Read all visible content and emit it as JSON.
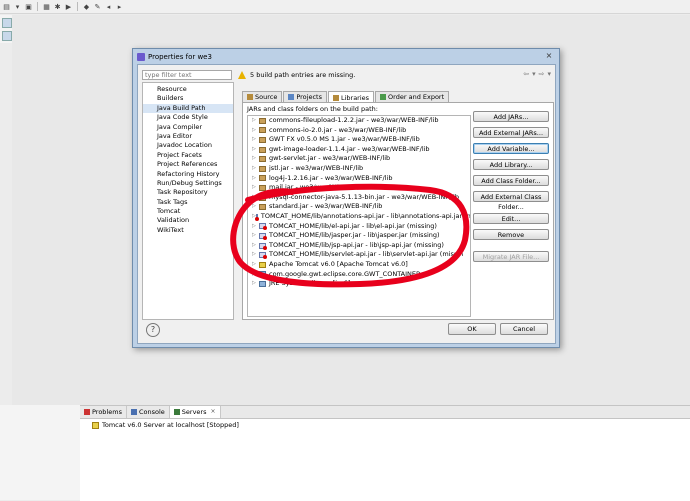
{
  "dialog": {
    "title": "Properties for we3",
    "close_glyph": "×",
    "filter_placeholder": "type filter text",
    "nav_items": [
      "Resource",
      "Builders",
      "Java Build Path",
      "Java Code Style",
      "Java Compiler",
      "Java Editor",
      "Javadoc Location",
      "Project Facets",
      "Project References",
      "Refactoring History",
      "Run/Debug Settings",
      "Task Repository",
      "Task Tags",
      "Tomcat",
      "Validation",
      "WikiText"
    ],
    "selected_nav": "Java Build Path",
    "warning": "5 build path entries are missing.",
    "tabs": [
      "Source",
      "Projects",
      "Libraries",
      "Order and Export"
    ],
    "active_tab": "Libraries",
    "panel_label": "JARs and class folders on the build path:",
    "entries": [
      {
        "label": "commons-fileupload-1.2.2.jar - we3/war/WEB-INF/lib",
        "kind": "jar"
      },
      {
        "label": "commons-io-2.0.jar - we3/war/WEB-INF/lib",
        "kind": "jar"
      },
      {
        "label": "GWT FX v0.5.0 MS 1.jar - we3/war/WEB-INF/lib",
        "kind": "jar"
      },
      {
        "label": "gwt-image-loader-1.1.4.jar - we3/war/WEB-INF/lib",
        "kind": "jar"
      },
      {
        "label": "gwt-servlet.jar - we3/war/WEB-INF/lib",
        "kind": "jar"
      },
      {
        "label": "jstl.jar - we3/war/WEB-INF/lib",
        "kind": "jar"
      },
      {
        "label": "log4j-1.2.16.jar - we3/war/WEB-INF/lib",
        "kind": "jar"
      },
      {
        "label": "mail.jar - we3/war/WEB-INF/lib",
        "kind": "jar"
      },
      {
        "label": "mysql-connector-java-5.1.13-bin.jar - we3/war/WEB-INF/lib",
        "kind": "jar"
      },
      {
        "label": "standard.jar - we3/war/WEB-INF/lib",
        "kind": "jar"
      },
      {
        "label": "TOMCAT_HOME/lib/annotations-api.jar - lib\\annotations-api.jar (m",
        "kind": "missing"
      },
      {
        "label": "TOMCAT_HOME/lib/el-api.jar - lib\\el-api.jar (missing)",
        "kind": "missing"
      },
      {
        "label": "TOMCAT_HOME/lib/jasper.jar - lib\\jasper.jar (missing)",
        "kind": "missing"
      },
      {
        "label": "TOMCAT_HOME/lib/jsp-api.jar - lib\\jsp-api.jar (missing)",
        "kind": "missing"
      },
      {
        "label": "TOMCAT_HOME/lib/servlet-api.jar - lib\\servlet-api.jar (missin",
        "kind": "missing"
      },
      {
        "label": "Apache Tomcat v6.0 [Apache Tomcat v6.0]",
        "kind": "server"
      },
      {
        "label": "com.google.gwt.eclipse.core.GWT_CONTAINER",
        "kind": "lib"
      },
      {
        "label": "JRE System Library [jre6]",
        "kind": "lib"
      }
    ],
    "buttons": [
      {
        "label": "Add JARs...",
        "state": "normal"
      },
      {
        "label": "Add External JARs...",
        "state": "normal"
      },
      {
        "label": "Add Variable...",
        "state": "focus"
      },
      {
        "label": "Add Library...",
        "state": "normal"
      },
      {
        "label": "Add Class Folder...",
        "state": "normal"
      },
      {
        "label": "Add External Class Folder...",
        "state": "normal"
      },
      {
        "label": "Edit...",
        "state": "normal"
      },
      {
        "label": "Remove",
        "state": "normal"
      },
      {
        "label": "Migrate JAR File...",
        "state": "disabled"
      }
    ],
    "help_glyph": "?",
    "ok_label": "OK",
    "cancel_label": "Cancel"
  },
  "views": {
    "tabs": [
      "Problems",
      "Console",
      "Servers"
    ],
    "active_tab": "Servers",
    "server_entry": "Tomcat v6.0 Server at localhost  [Stopped]"
  },
  "colors": {
    "annotation": "#e8001c",
    "selection": "#d7e5f5",
    "dialog_frame": "#bcd0e6"
  }
}
